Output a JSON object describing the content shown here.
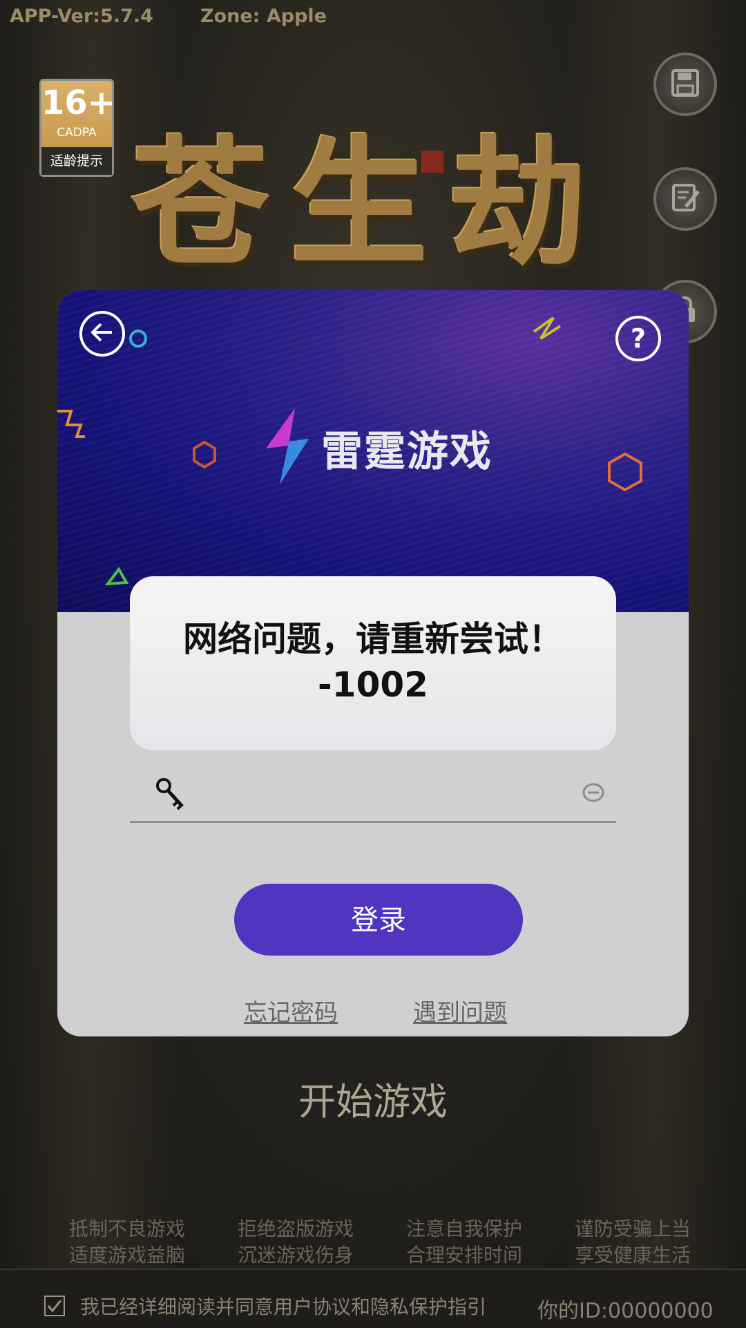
{
  "app": {
    "version": "APP-Ver:5.7.4",
    "zone": "Zone: Apple"
  },
  "age_rating": {
    "age": "16+",
    "org": "CADPA",
    "tip": "适龄提示"
  },
  "game_logo": "苍生劫",
  "side_buttons": [
    "save-icon",
    "notes-icon",
    "lock-icon"
  ],
  "login_dialog": {
    "brand": "雷霆游戏",
    "back_icon": "arrow-left-icon",
    "help_icon": "question-icon",
    "password_placeholder": "",
    "login_label": "登录",
    "forgot_password": "忘记密码",
    "problem": "遇到问题"
  },
  "toast": {
    "message": "网络问题，请重新尝试！",
    "code": "-1002"
  },
  "start_game": "开始游戏",
  "health_notice": [
    [
      "抵制不良游戏",
      "拒绝盗版游戏",
      "注意自我保护",
      "谨防受骗上当"
    ],
    [
      "适度游戏益脑",
      "沉迷游戏伤身",
      "合理安排时间",
      "享受健康生活"
    ]
  ],
  "footer": {
    "agreement": "我已经详细阅读并同意用户协议和隐私保护指引",
    "user_id": "你的ID:00000000"
  },
  "colors": {
    "accent": "#4f35bf",
    "banner": "#16137a",
    "dialog_bg": "#d0d0d0"
  }
}
